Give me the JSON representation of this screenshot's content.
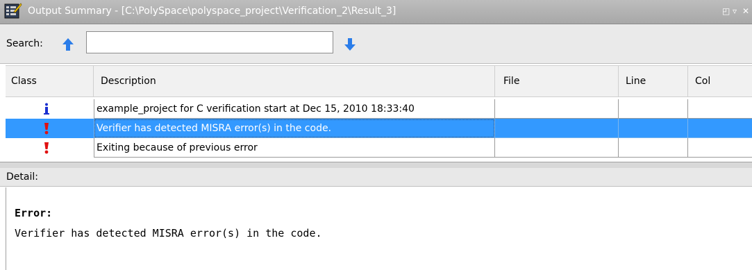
{
  "window": {
    "title": "Output Summary - [C:\\PolySpace\\polyspace_project\\Verification_2\\Result_3]",
    "controls": [
      "◰",
      "▿",
      "✕"
    ]
  },
  "search": {
    "label": "Search:",
    "value": "",
    "placeholder": ""
  },
  "table": {
    "columns": [
      "Class",
      "Description",
      "File",
      "Line",
      "Col"
    ],
    "rows": [
      {
        "class_icon": "info-icon",
        "description": "example_project for C verification start at Dec 15, 2010 18:33:40",
        "file": "",
        "line": "",
        "col": ""
      },
      {
        "class_icon": "error-icon",
        "description": "Verifier has detected MISRA error(s) in the code.",
        "file": "",
        "line": "",
        "col": ""
      },
      {
        "class_icon": "error-icon",
        "description": "Exiting because of previous error",
        "file": "",
        "line": "",
        "col": ""
      }
    ],
    "selected_row": 1
  },
  "detail": {
    "label": "Detail:",
    "heading": "Error:",
    "message": "Verifier has detected MISRA error(s) in the code."
  },
  "colors": {
    "selection": "#3399ff",
    "info_icon": "#1a2fd0",
    "error_icon": "#e01010",
    "arrow": "#2b7de9"
  }
}
